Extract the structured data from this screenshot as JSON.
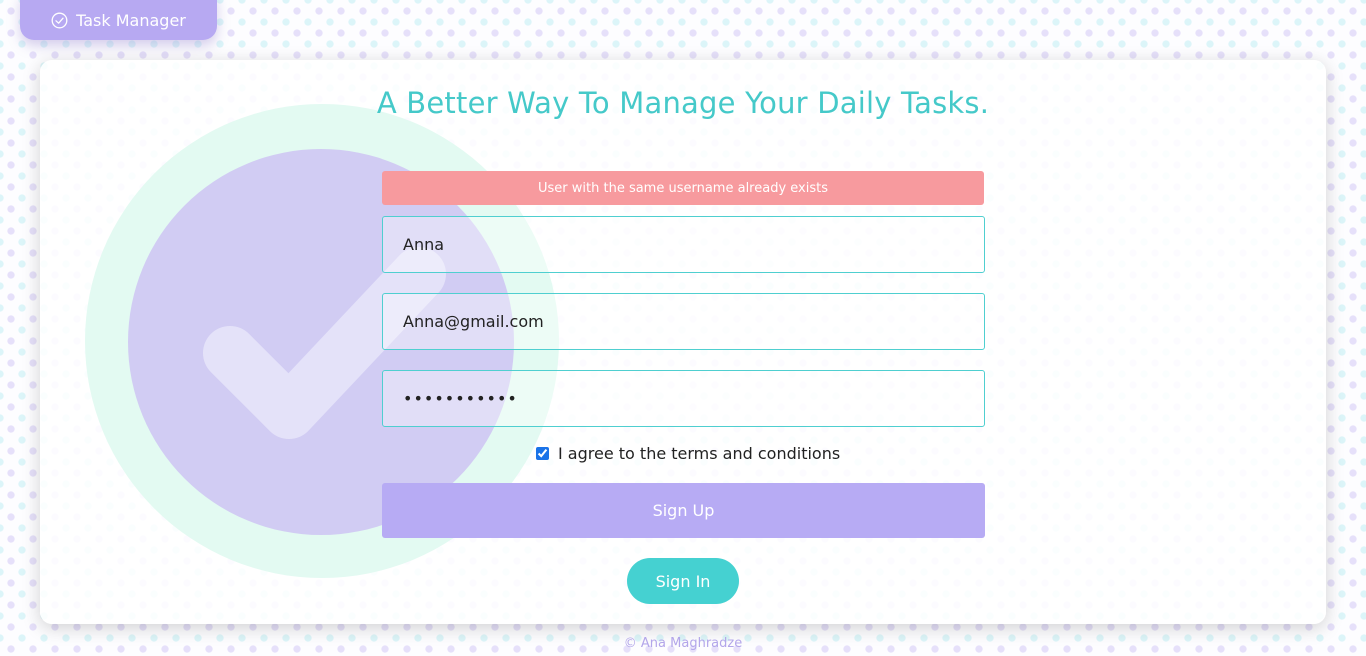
{
  "brand": {
    "title": "Task Manager",
    "icon": "check-circle-icon"
  },
  "main": {
    "headline": "A Better Way To Manage Your Daily Tasks."
  },
  "alert": {
    "message": "User with the same username already exists"
  },
  "form": {
    "username_value": "Anna",
    "email_value": "Anna@gmail.com",
    "password_value": "•••••••••••",
    "terms_checked": true,
    "terms_label": "I agree to the terms and conditions",
    "signup_label": "Sign Up",
    "signin_label": "Sign In"
  },
  "footer": {
    "credit": "© Ana Maghradze"
  },
  "colors": {
    "brand_purple": "#b7a9f2",
    "accent_teal": "#45c9c9",
    "alert_red": "#f79a9e"
  }
}
